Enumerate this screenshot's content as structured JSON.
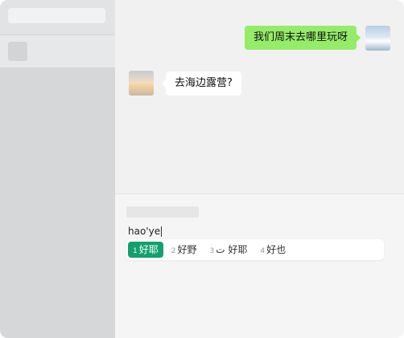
{
  "chat": {
    "messages": [
      {
        "side": "right",
        "text": "我们周末去哪里玩呀"
      },
      {
        "side": "left",
        "text": "去海边露营?"
      }
    ]
  },
  "input": {
    "text": "hao'ye"
  },
  "ime": {
    "candidates": [
      {
        "num": "1",
        "text": "好耶",
        "selected": true
      },
      {
        "num": "2",
        "text": "好野"
      },
      {
        "num": "3",
        "text": "ت 好耶"
      },
      {
        "num": "4",
        "text": "好也"
      }
    ]
  },
  "colors": {
    "bubble_sent": "#95ec69",
    "bubble_received": "#ffffff",
    "ime_selected": "#12a06f",
    "sidebar": "#d6d7d9"
  }
}
